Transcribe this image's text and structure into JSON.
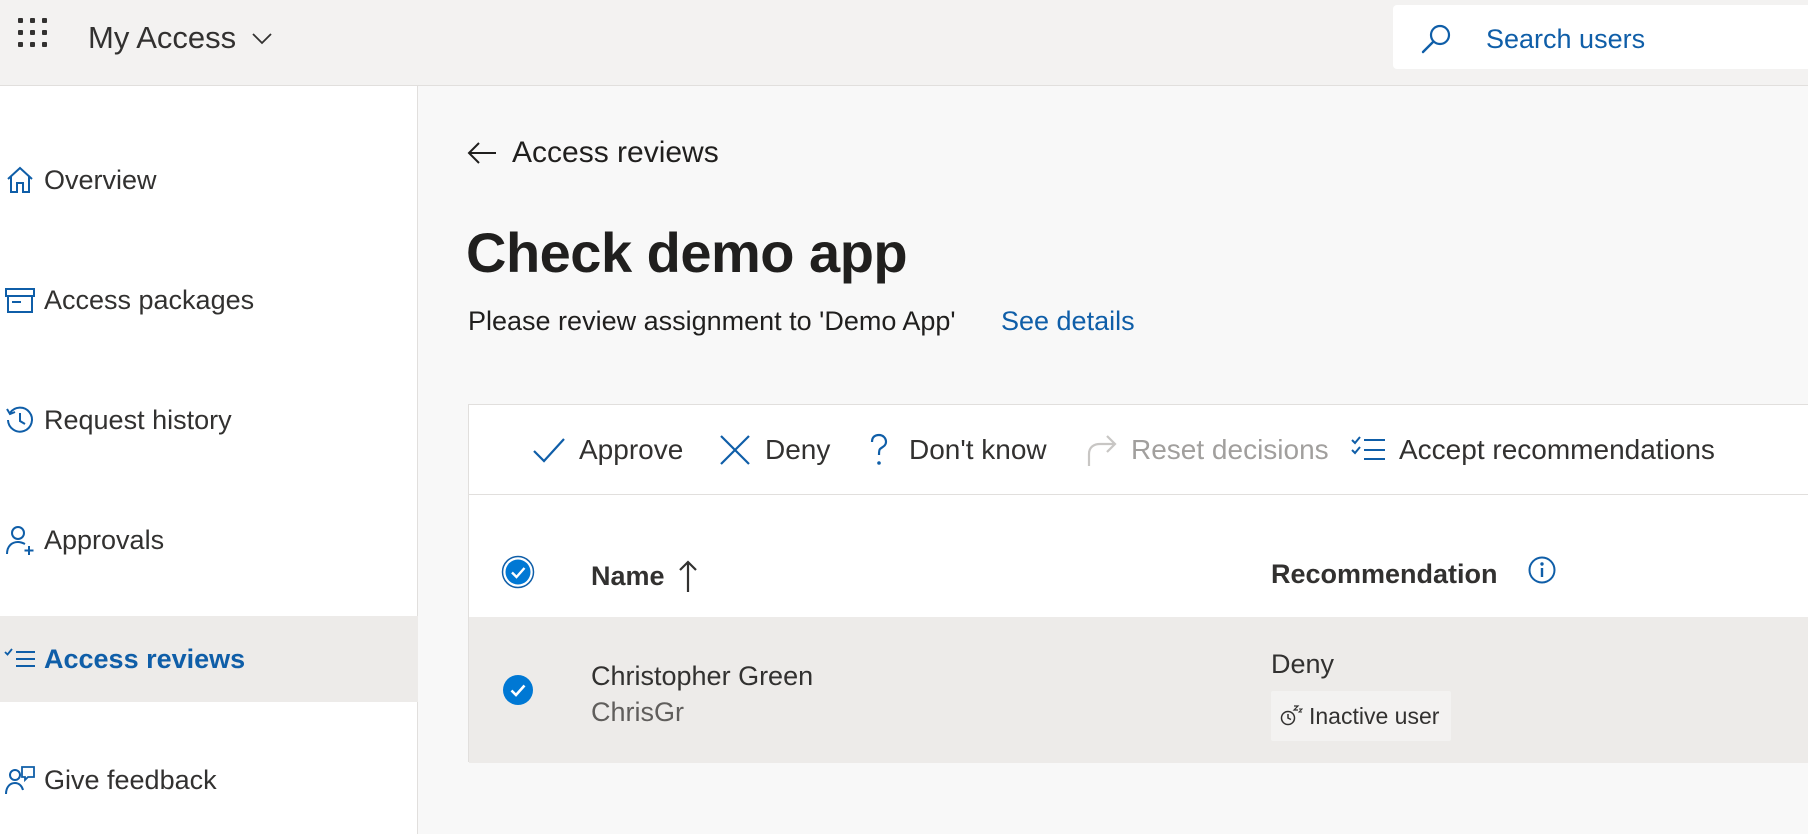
{
  "header": {
    "app_title": "My Access",
    "search_placeholder": "Search users"
  },
  "sidebar": {
    "items": [
      {
        "label": "Overview",
        "icon": "home-icon",
        "active": false
      },
      {
        "label": "Access packages",
        "icon": "package-icon",
        "active": false
      },
      {
        "label": "Request history",
        "icon": "history-icon",
        "active": false
      },
      {
        "label": "Approvals",
        "icon": "person-add-icon",
        "active": false
      },
      {
        "label": "Access reviews",
        "icon": "checklist-icon",
        "active": true
      },
      {
        "label": "Give feedback",
        "icon": "feedback-icon",
        "active": false
      }
    ]
  },
  "main": {
    "back_label": "Access reviews",
    "title": "Check demo app",
    "subtitle": "Please review assignment to 'Demo App'",
    "see_details": "See details"
  },
  "toolbar": {
    "approve": "Approve",
    "deny": "Deny",
    "dont_know": "Don't know",
    "reset": "Reset decisions",
    "accept": "Accept recommendations"
  },
  "table": {
    "columns": {
      "name": "Name",
      "recommendation": "Recommendation"
    },
    "rows": [
      {
        "name": "Christopher Green",
        "upn": "ChrisGr",
        "recommendation": "Deny",
        "tag": "Inactive user",
        "selected": true
      }
    ]
  },
  "colors": {
    "accent": "#0f5ea8",
    "checkbox": "#0078d4",
    "active_nav_bg": "#edebe9"
  }
}
